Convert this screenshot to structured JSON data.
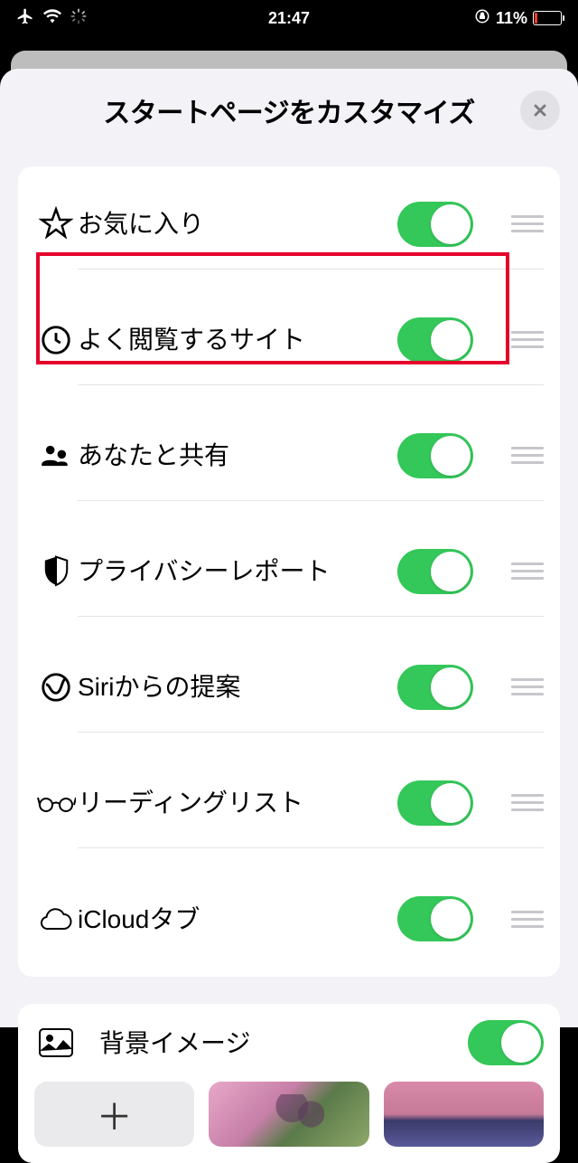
{
  "status": {
    "time": "21:47",
    "battery_pct": "11%"
  },
  "sheet": {
    "title": "スタートページをカスタマイズ",
    "items": [
      {
        "icon": "star",
        "label": "お気に入り",
        "on": true
      },
      {
        "icon": "clock",
        "label": "よく閲覧するサイト",
        "on": true
      },
      {
        "icon": "people",
        "label": "あなたと共有",
        "on": true
      },
      {
        "icon": "shield",
        "label": "プライバシーレポート",
        "on": true
      },
      {
        "icon": "siri",
        "label": "Siriからの提案",
        "on": true
      },
      {
        "icon": "glasses",
        "label": "リーディングリスト",
        "on": true
      },
      {
        "icon": "cloud",
        "label": "iCloudタブ",
        "on": true
      }
    ],
    "background_section": {
      "label": "背景イメージ",
      "on": true
    }
  },
  "highlight_index": 1
}
